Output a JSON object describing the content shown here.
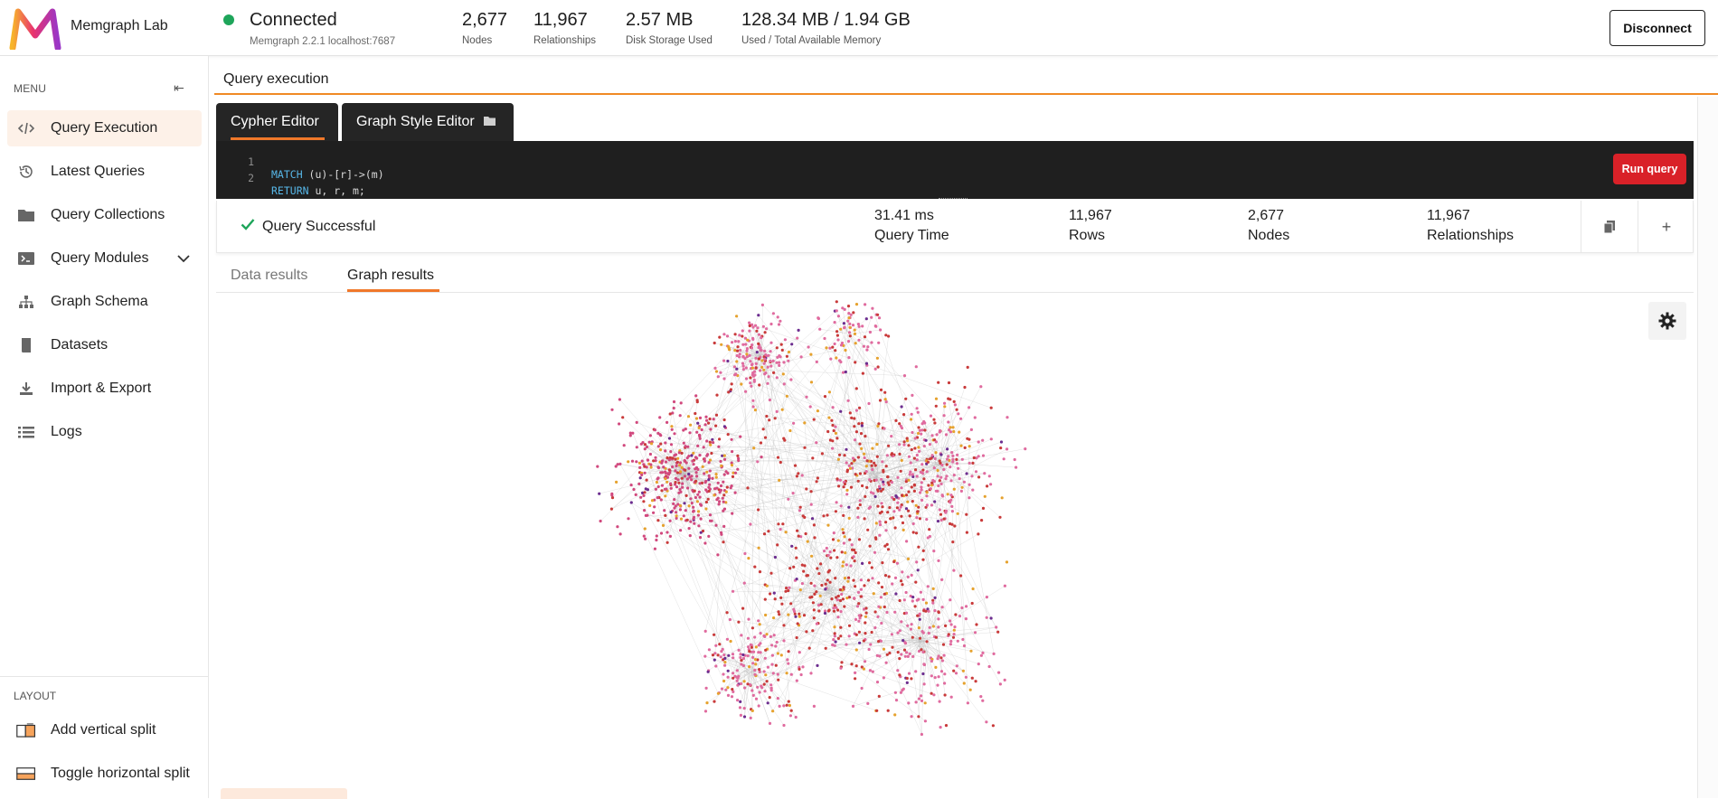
{
  "app": {
    "name": "Memgraph Lab",
    "logo_icon": "memgraph-m-logo"
  },
  "connection": {
    "status": "Connected",
    "status_color": "#1ea55a",
    "version": "Memgraph 2.2.1",
    "host": "localhost:7687",
    "sub": "Memgraph 2.2.1  localhost:7687"
  },
  "stats": [
    {
      "value": "2,677",
      "label": "Nodes"
    },
    {
      "value": "11,967",
      "label": "Relationships"
    },
    {
      "value": "2.57 MB",
      "label": "Disk Storage Used"
    },
    {
      "value": "128.34 MB / 1.94 GB",
      "label": "Used / Total Available Memory"
    }
  ],
  "disconnect_label": "Disconnect",
  "sidebar": {
    "menu_heading": "MENU",
    "items": [
      {
        "label": "Query Execution",
        "icon": "code-icon",
        "active": true
      },
      {
        "label": "Latest Queries",
        "icon": "history-icon"
      },
      {
        "label": "Query Collections",
        "icon": "folder-icon"
      },
      {
        "label": "Query Modules",
        "icon": "terminal-icon",
        "expandable": true
      },
      {
        "label": "Graph Schema",
        "icon": "schema-icon"
      },
      {
        "label": "Datasets",
        "icon": "book-icon"
      },
      {
        "label": "Import & Export",
        "icon": "download-icon"
      },
      {
        "label": "Logs",
        "icon": "list-icon"
      }
    ],
    "layout_heading": "LAYOUT",
    "layout_items": [
      {
        "label": "Add vertical split",
        "icon": "vertical-split-icon"
      },
      {
        "label": "Toggle horizontal split",
        "icon": "horizontal-split-icon"
      }
    ]
  },
  "main": {
    "title": "Query execution",
    "accent": "#f08a24",
    "tabs": [
      {
        "label": "Cypher Editor",
        "active": true
      },
      {
        "label": "Graph Style Editor",
        "icon": "folder-open-icon"
      }
    ],
    "code_lines": [
      {
        "num": "1",
        "keyword": "MATCH",
        "rest": " (u)-[r]->(m)"
      },
      {
        "num": "2",
        "keyword": "RETURN",
        "rest": " u, r, m;"
      }
    ],
    "run_label": "Run query",
    "run_color": "#d92128"
  },
  "result": {
    "status": "Query Successful",
    "stats": [
      {
        "value": "31.41 ms",
        "label": "Query Time"
      },
      {
        "value": "11,967",
        "label": "Rows"
      },
      {
        "value": "2,677",
        "label": "Nodes"
      },
      {
        "value": "11,967",
        "label": "Relationships"
      }
    ],
    "copy_icon": "copy-icon",
    "add_icon": "plus-icon"
  },
  "result_tabs": [
    {
      "label": "Data results",
      "active": false
    },
    {
      "label": "Graph results",
      "active": true
    }
  ],
  "graph": {
    "settings_icon": "gear-icon",
    "node_colors": [
      "#e06b9f",
      "#d1497e",
      "#c93a3a",
      "#e6a22e",
      "#6c2d8f"
    ],
    "edge_color": "#b9b9b9"
  }
}
